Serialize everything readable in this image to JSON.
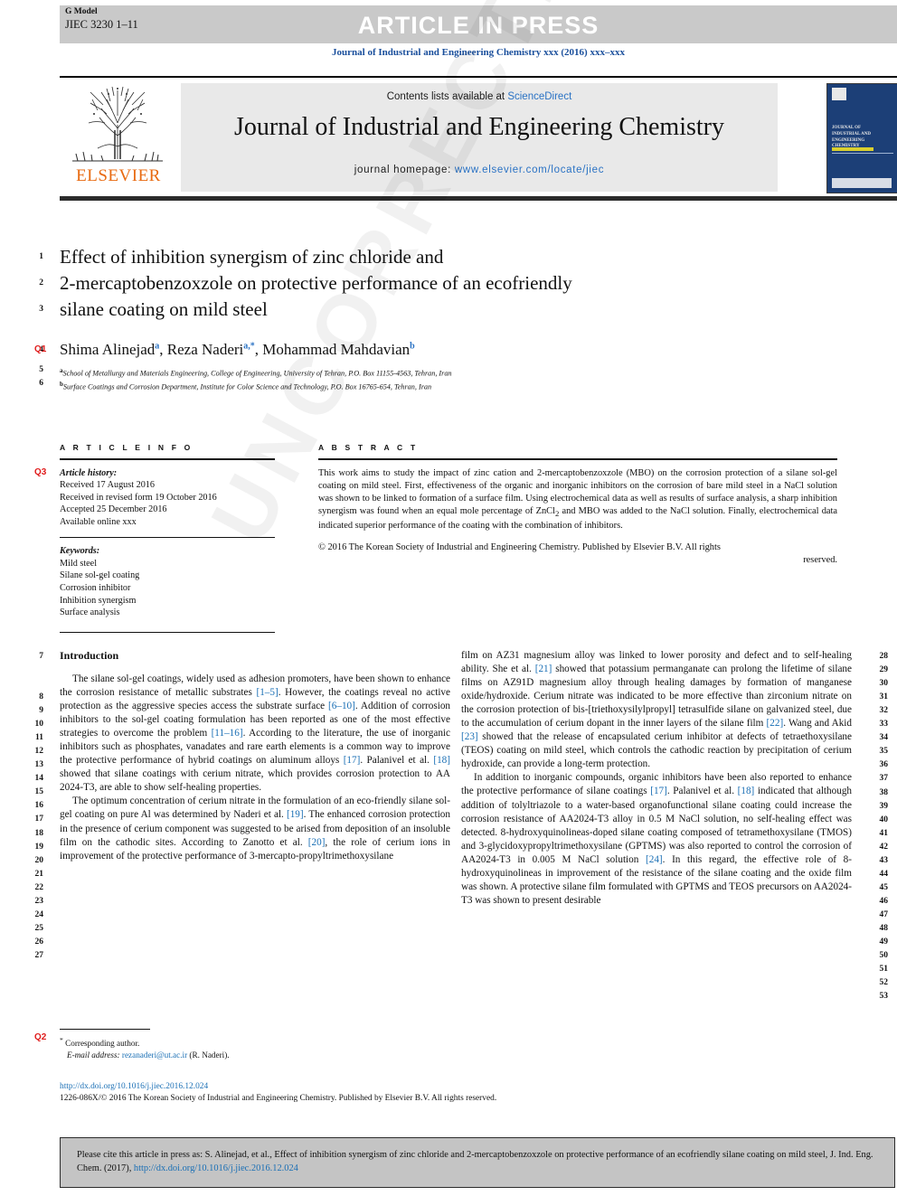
{
  "header": {
    "g_model": "G Model",
    "manuscript_id": "JIEC 3230 1–11",
    "status_banner": "ARTICLE IN PRESS",
    "running_head": "Journal of Industrial and Engineering Chemistry xxx (2016) xxx–xxx"
  },
  "masthead": {
    "contents_prefix": "Contents lists available at ",
    "sciencedirect": "ScienceDirect",
    "journal_title": "Journal of Industrial and Engineering Chemistry",
    "homepage_label": "journal homepage: ",
    "homepage_url": "www.elsevier.com/locate/jiec",
    "publisher": "ELSEVIER",
    "cover_title": "JOURNAL OF INDUSTRIAL AND ENGINEERING CHEMISTRY"
  },
  "article": {
    "title_line1": "Effect of inhibition synergism of zinc chloride and",
    "title_line2": "2-mercaptobenzoxzole on protective performance of an ecofriendly",
    "title_line3": "silane coating on mild steel",
    "authors": [
      {
        "name": "Shima Alinejad",
        "sup": "a"
      },
      {
        "name": "Reza Naderi",
        "sup": "a,*"
      },
      {
        "name": "Mohammad Mahdavian",
        "sup": "b"
      }
    ],
    "affiliation_a": "School of Metallurgy and Materials Engineering, College of Engineering, University of Tehran, P.O. Box 11155-4563, Tehran, Iran",
    "affiliation_a_sup": "a",
    "affiliation_b": "Surface Coatings and Corrosion Department, Institute for Color Science and Technology, P.O. Box 16765-654, Tehran, Iran",
    "affiliation_b_sup": "b"
  },
  "article_info": {
    "heading": "A R T I C L E  I N F O",
    "history_label": "Article history:",
    "history": [
      "Received 17 August 2016",
      "Received in revised form 19 October 2016",
      "Accepted 25 December 2016",
      "Available online xxx"
    ],
    "keywords_label": "Keywords:",
    "keywords": [
      "Mild steel",
      "Silane sol-gel coating",
      "Corrosion inhibitor",
      "Inhibition synergism",
      "Surface analysis"
    ]
  },
  "abstract": {
    "heading": "A B S T R A C T",
    "text": "This work aims to study the impact of zinc cation and 2-mercaptobenzoxzole (MBO) on the corrosion protection of a silane sol-gel coating on mild steel. First, effectiveness of the organic and inorganic inhibitors on the corrosion of bare mild steel in a NaCl solution was shown to be linked to formation of a surface film. Using electrochemical data as well as results of surface analysis, a sharp inhibition synergism was found when an equal mole percentage of ZnCl2 and MBO was added to the NaCl solution. Finally, electrochemical data indicated superior performance of the coating with the combination of inhibitors.",
    "copyright": "© 2016 The Korean Society of Industrial and Engineering Chemistry. Published by Elsevier B.V. All rights",
    "copyright_end": "reserved."
  },
  "body": {
    "section_heading": "Introduction",
    "left_paragraphs": [
      "The silane sol-gel coatings, widely used as adhesion promoters, have been shown to enhance the corrosion resistance of metallic substrates [1–5]. However, the coatings reveal no active protection as the aggressive species access the substrate surface [6–10]. Addition of corrosion inhibitors to the sol-gel coating formulation has been reported as one of the most effective strategies to overcome the problem [11–16]. According to the literature, the use of inorganic inhibitors such as phosphates, vanadates and rare earth elements is a common way to improve the protective performance of hybrid coatings on aluminum alloys [17]. Palanivel et al. [18] showed that silane coatings with cerium nitrate, which provides corrosion protection to AA 2024-T3, are able to show self-healing properties.",
      "The optimum concentration of cerium nitrate in the formulation of an eco-friendly silane sol-gel coating on pure Al was determined by Naderi et al. [19]. The enhanced corrosion protection in the presence of cerium component was suggested to be arised from deposition of an insoluble film on the cathodic sites. According to Zanotto et al. [20], the role of cerium ions in improvement of the protective performance of 3-mercapto-propyltrimethoxysilane"
    ],
    "right_paragraphs": [
      "film on AZ31 magnesium alloy was linked to lower porosity and defect and to self-healing ability. She et al. [21] showed that potassium permanganate can prolong the lifetime of silane films on AZ91D magnesium alloy through healing damages by formation of manganese oxide/hydroxide. Cerium nitrate was indicated to be more effective than zirconium nitrate on the corrosion protection of bis-[triethoxysilylpropyl] tetrasulfide silane on galvanized steel, due to the accumulation of cerium dopant in the inner layers of the silane film [22]. Wang and Akid [23] showed that the release of encapsulated cerium inhibitor at defects of tetraethoxysilane (TEOS) coating on mild steel, which controls the cathodic reaction by precipitation of cerium hydroxide, can provide a long-term protection.",
      "In addition to inorganic compounds, organic inhibitors have been also reported to enhance the protective performance of silane coatings [17]. Palanivel et al. [18] indicated that although addition of tolyltriazole to a water-based organofunctional silane coating could increase the corrosion resistance of AA2024-T3 alloy in 0.5 M NaCl solution, no self-healing effect was detected. 8-hydroxyquinolineas-doped silane coating composed of tetramethoxysilane (TMOS) and 3-glycidoxypropyltrimethoxysilane (GPTMS) was also reported to control the corrosion of AA2024-T3 in 0.005 M NaCl solution [24]. In this regard, the effective role of 8-hydroxyquinolineas in improvement of the resistance of the silane coating and the oxide film was shown. A protective silane film formulated with GPTMS and TEOS precursors on AA2024-T3 was shown to present desirable"
    ]
  },
  "footnote": {
    "corresponding_marker": "*",
    "corresponding_label": "Corresponding author.",
    "email_label": "E-mail address:",
    "email": "rezanaderi@ut.ac.ir",
    "email_owner": "(R. Naderi)."
  },
  "doi_block": {
    "doi_url": "http://dx.doi.org/10.1016/j.jiec.2016.12.024",
    "copyright_line": "1226-086X/© 2016 The Korean Society of Industrial and Engineering Chemistry. Published by Elsevier B.V. All rights reserved."
  },
  "cite_box": {
    "text": "Please cite this article in press as: S. Alinejad, et al., Effect of inhibition synergism of zinc chloride and 2-mercaptobenzoxzole on protective performance of an ecofriendly silane coating on mild steel, J. Ind. Eng. Chem. (2017), ",
    "link": "http://dx.doi.org/10.1016/j.jiec.2016.12.024"
  },
  "line_numbers": {
    "title_block": [
      "1",
      "2",
      "3",
      "4",
      "5",
      "6"
    ],
    "left_column": [
      "7",
      "8",
      "9",
      "10",
      "11",
      "12",
      "13",
      "14",
      "15",
      "16",
      "17",
      "18",
      "19",
      "20",
      "21",
      "22",
      "23",
      "24",
      "25",
      "26",
      "27"
    ],
    "right_column": [
      "28",
      "29",
      "30",
      "31",
      "32",
      "33",
      "34",
      "35",
      "36",
      "37",
      "38",
      "39",
      "40",
      "41",
      "42",
      "43",
      "44",
      "45",
      "46",
      "47",
      "48",
      "49",
      "50",
      "51",
      "52",
      "53"
    ]
  },
  "query_markers": {
    "q1": "Q1",
    "q2": "Q2",
    "q3": "Q3"
  },
  "watermark": {
    "text": "UNCORRECTED PROOF"
  },
  "colors": {
    "link": "#1a6fb5",
    "journal_blue": "#1a4f9c",
    "elsevier_orange": "#e86a10",
    "query_red": "#e01b1b",
    "banner_grey": "#c9c9c9"
  }
}
